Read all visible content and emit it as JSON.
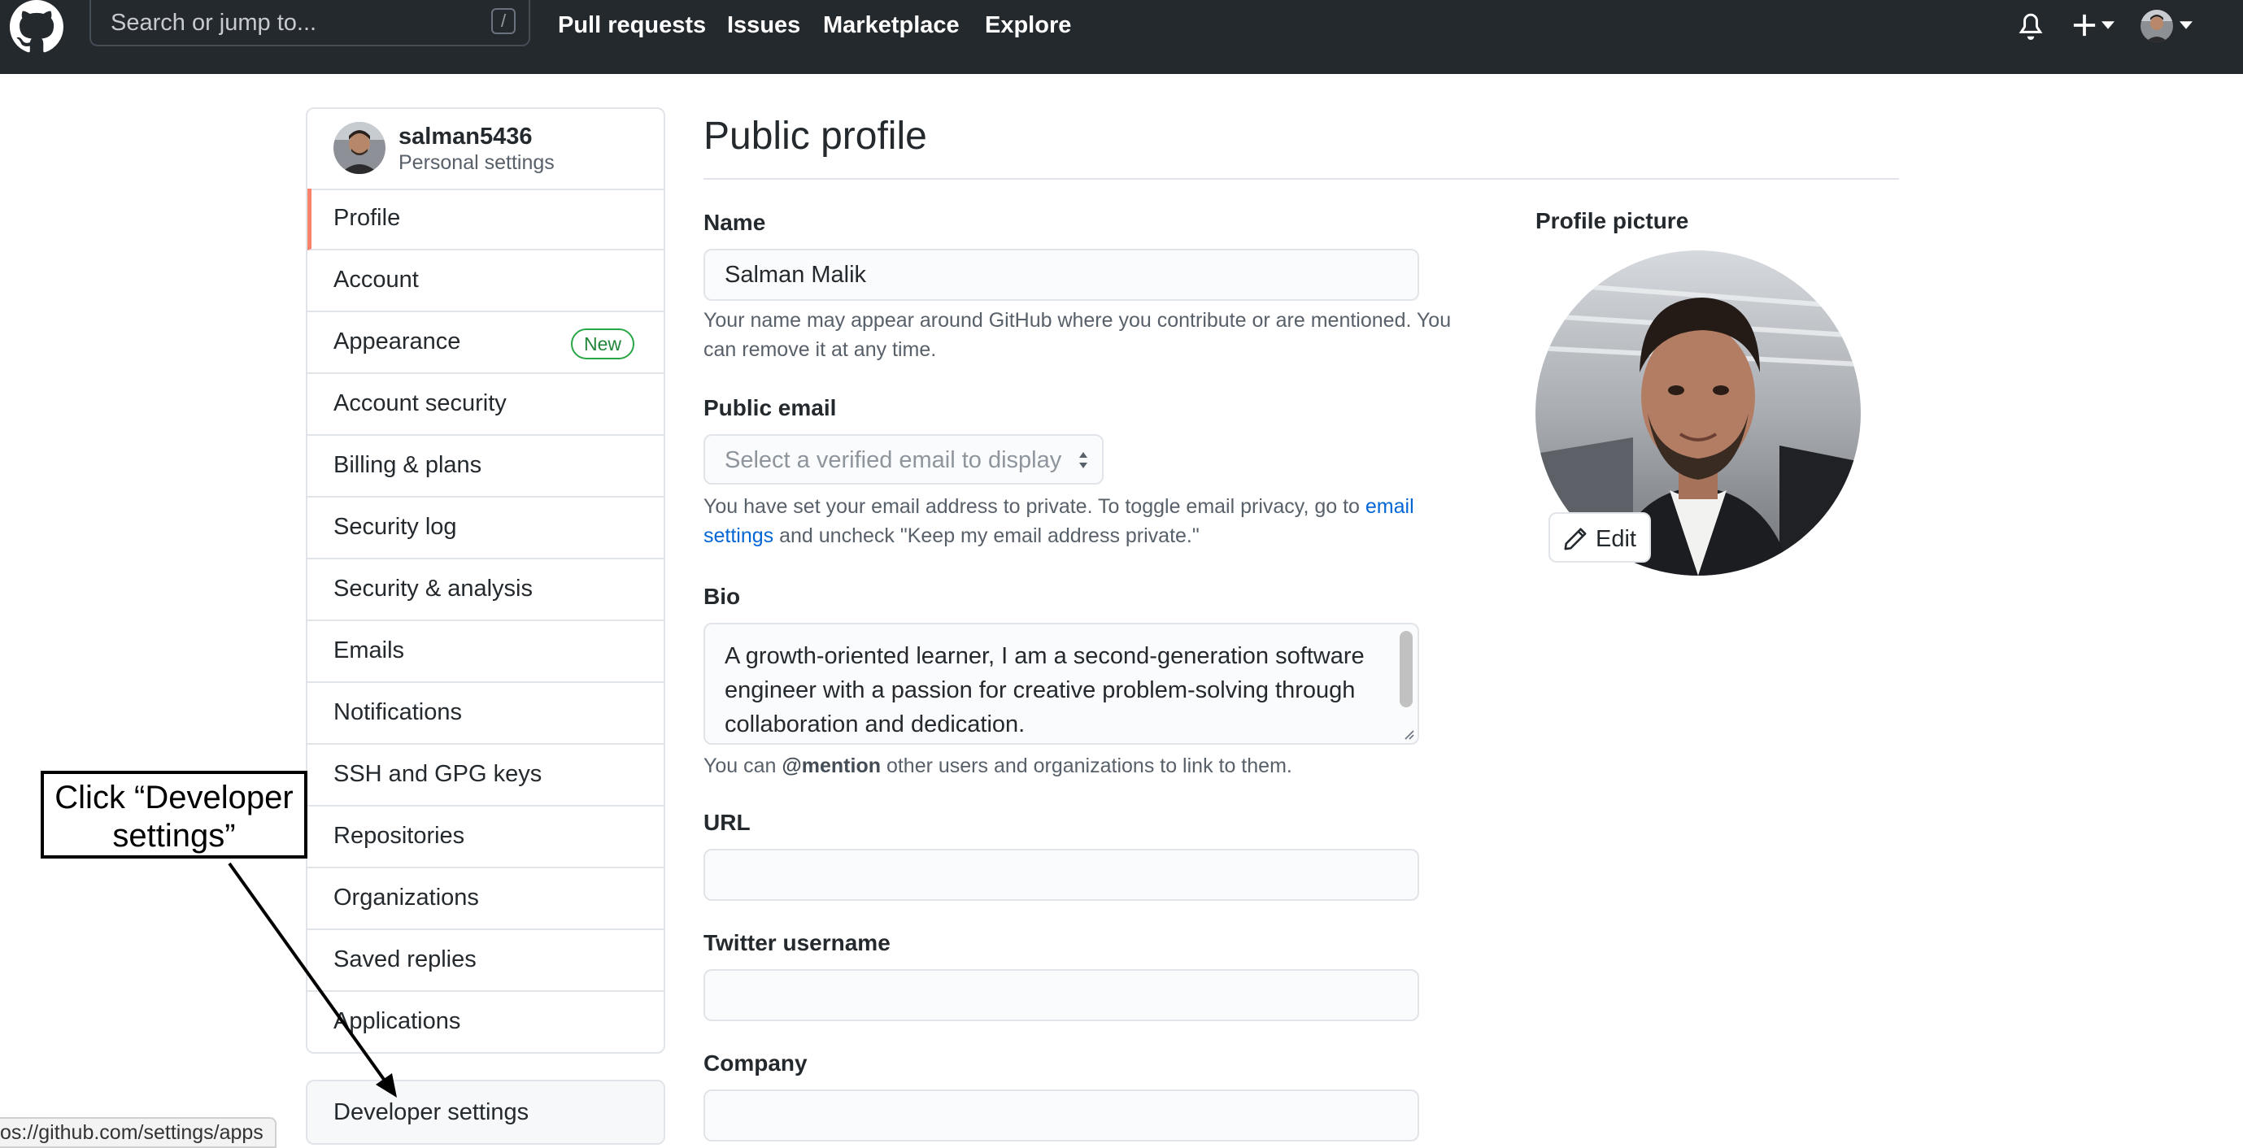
{
  "topbar": {
    "search_placeholder": "Search or jump to...",
    "search_key": "/",
    "nav": [
      "Pull requests",
      "Issues",
      "Marketplace",
      "Explore"
    ],
    "icons": [
      "github-logo",
      "bell-icon",
      "plus-icon",
      "avatar",
      "chevron-down-icon"
    ]
  },
  "sidebar": {
    "username": "salman5436",
    "subtitle": "Personal settings",
    "items": [
      {
        "label": "Profile",
        "active": true
      },
      {
        "label": "Account"
      },
      {
        "label": "Appearance",
        "badge": "New"
      },
      {
        "label": "Account security"
      },
      {
        "label": "Billing & plans"
      },
      {
        "label": "Security log"
      },
      {
        "label": "Security & analysis"
      },
      {
        "label": "Emails"
      },
      {
        "label": "Notifications"
      },
      {
        "label": "SSH and GPG keys"
      },
      {
        "label": "Repositories"
      },
      {
        "label": "Organizations"
      },
      {
        "label": "Saved replies"
      },
      {
        "label": "Applications"
      }
    ],
    "developer_settings": "Developer settings"
  },
  "main": {
    "title": "Public profile",
    "name_label": "Name",
    "name_value": "Salman Malik",
    "name_note": "Your name may appear around GitHub where you contribute or are mentioned. You can remove it at any time.",
    "email_label": "Public email",
    "email_placeholder": "Select a verified email to display",
    "email_note_pre": "You have set your email address to private. To toggle email privacy, go to ",
    "email_note_link": "email settings",
    "email_note_post": " and uncheck \"Keep my email address private.\"",
    "bio_label": "Bio",
    "bio_value": "A growth-oriented learner, I am a second-generation software engineer with a passion for creative problem-solving through collaboration and dedication.",
    "bio_note_pre": "You can ",
    "bio_note_bold": "@mention",
    "bio_note_post": " other users and organizations to link to them.",
    "url_label": "URL",
    "url_value": "",
    "twitter_label": "Twitter username",
    "twitter_value": "",
    "company_label": "Company",
    "company_value": ""
  },
  "profile_picture": {
    "label": "Profile picture",
    "edit_label": "Edit"
  },
  "annotation": {
    "text": "Click “Developer settings”"
  },
  "status_bar": {
    "url": "os://github.com/settings/apps"
  },
  "colors": {
    "header_bg": "#24292e",
    "active_accent": "#f9826c",
    "link": "#0366d6",
    "badge_green": "#28a745"
  }
}
